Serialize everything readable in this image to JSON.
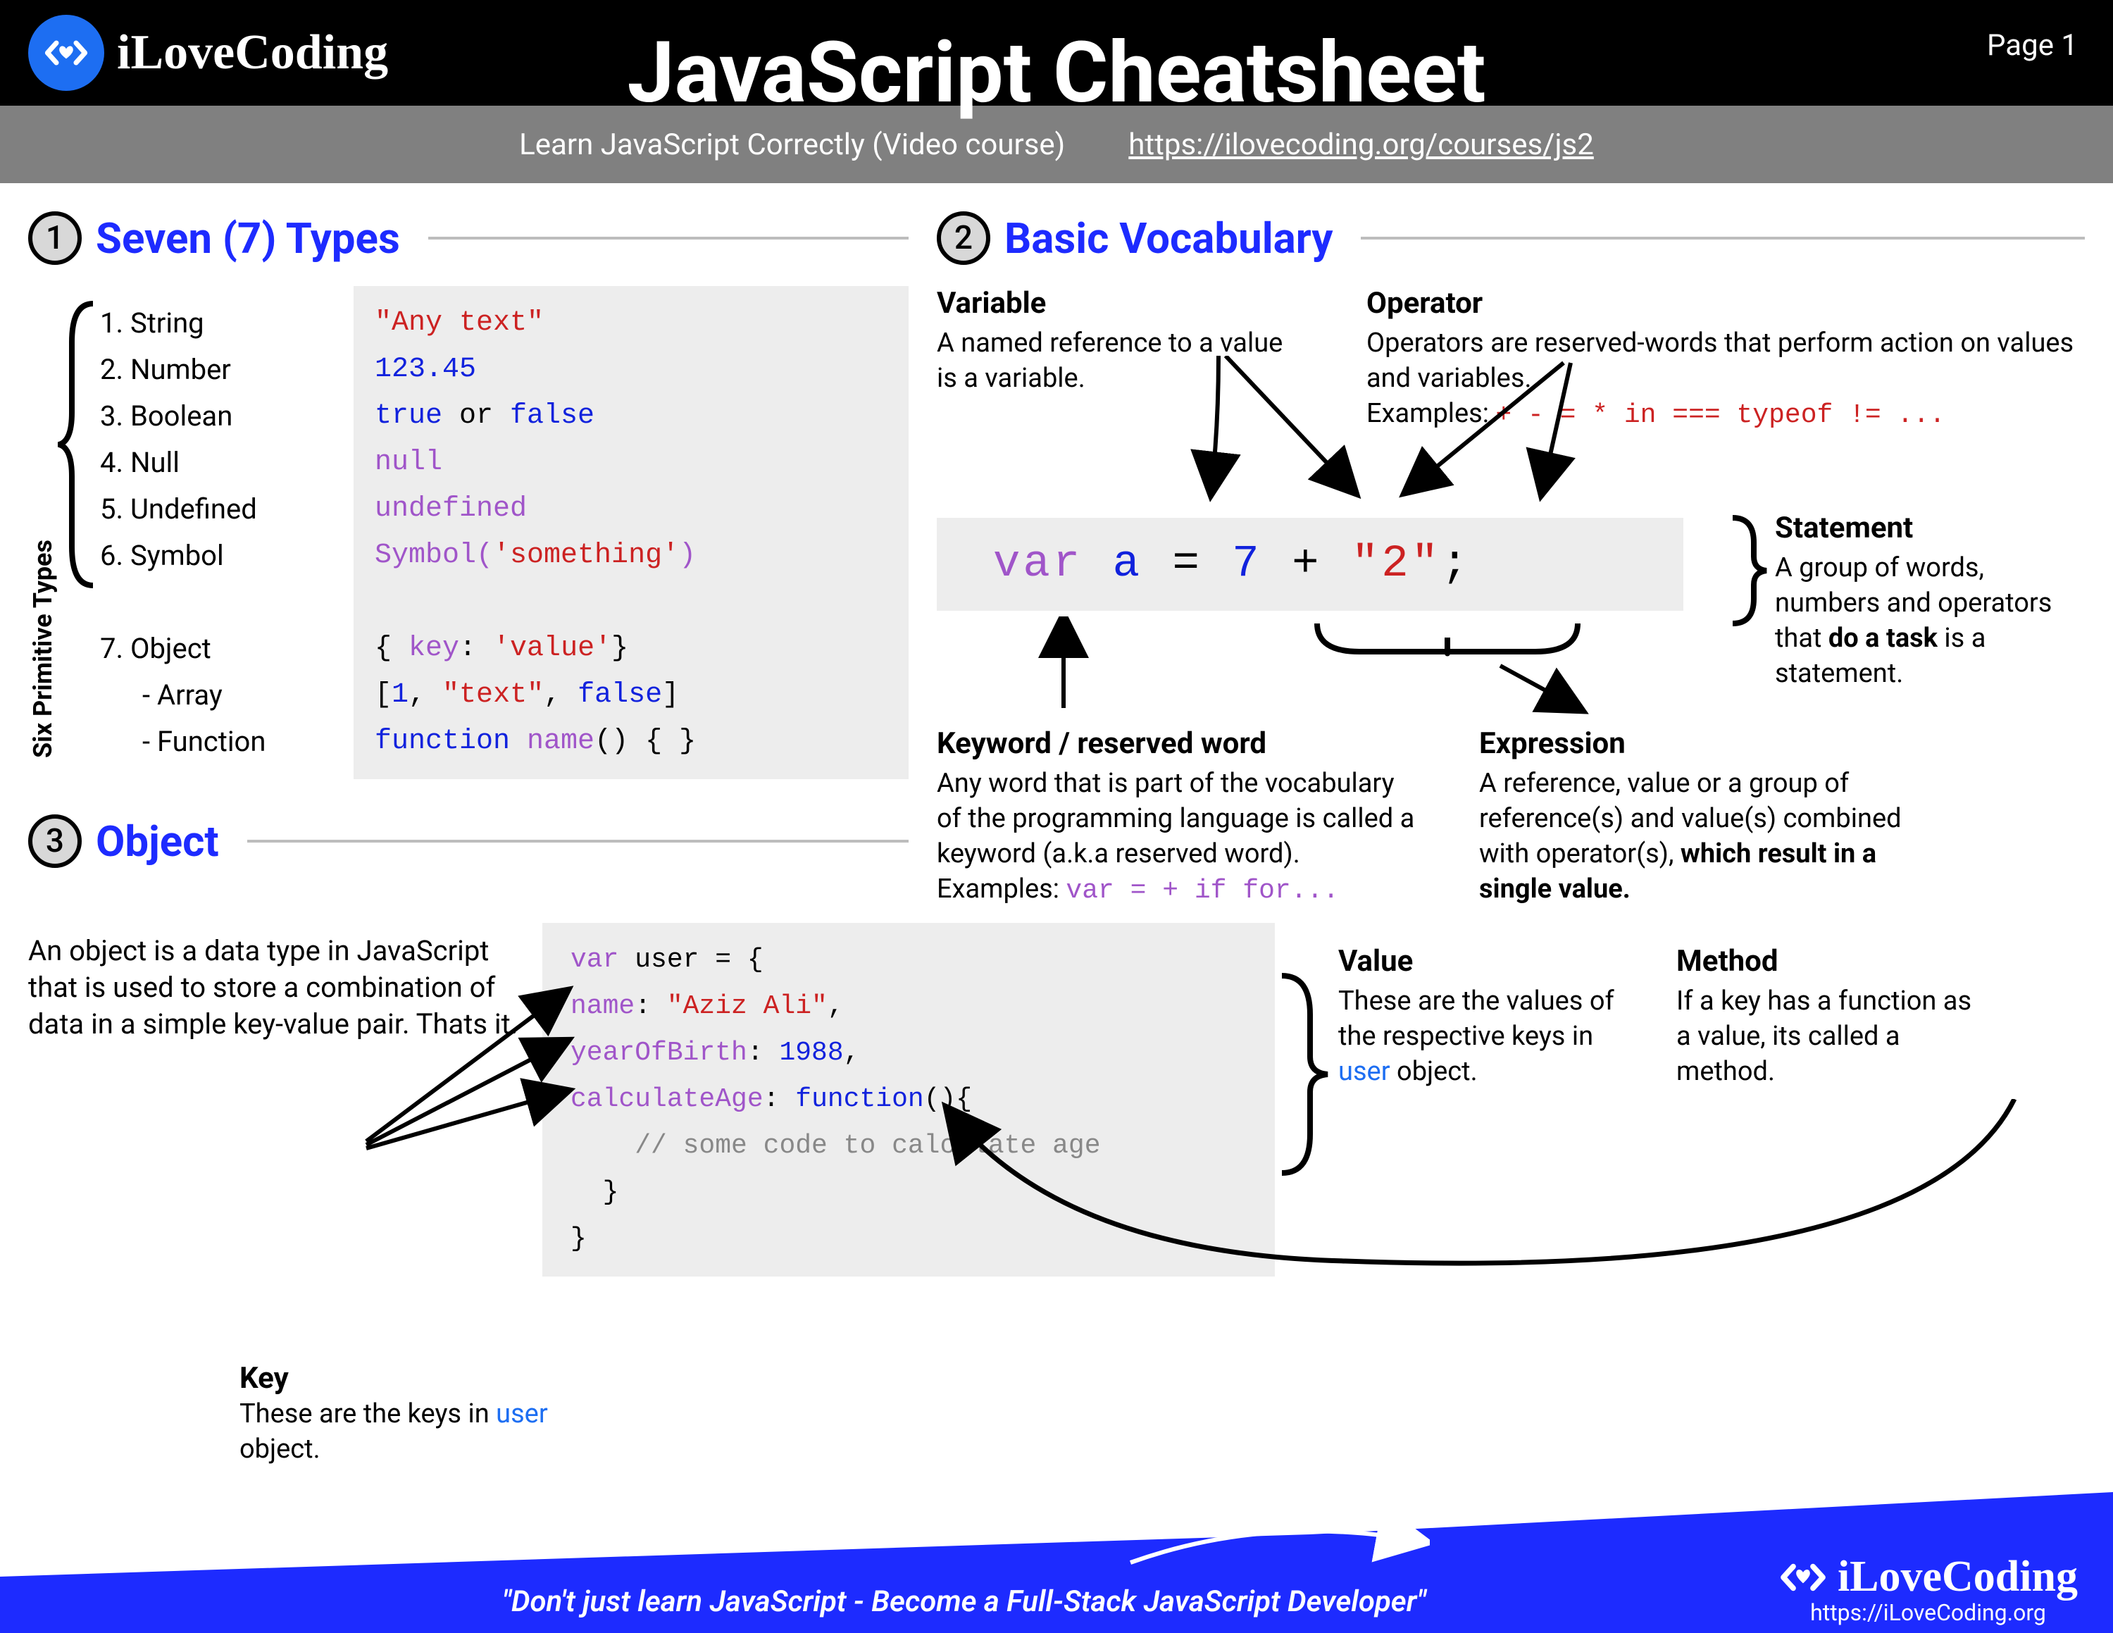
{
  "header": {
    "brand": "iLoveCoding",
    "title": "JavaScript Cheatsheet",
    "page": "Page 1",
    "subtitle_left": "Learn JavaScript Correctly (Video course)",
    "subtitle_link": "https://ilovecoding.org/courses/js2"
  },
  "section1": {
    "num": "1",
    "title": "Seven (7) Types",
    "side_label": "Six Primitive Types",
    "names": {
      "n1": "1.  String",
      "n2": "2.  Number",
      "n3": "3.  Boolean",
      "n4": "4.  Null",
      "n5": "5.  Undefined",
      "n6": "6.  Symbol",
      "n7": "7.  Object",
      "n7a": "-  Array",
      "n7b": "-  Function"
    },
    "code": {
      "l1a": "\"Any text\"",
      "l2a": "123.45",
      "l3a": "true",
      "l3b": " or ",
      "l3c": "false",
      "l4a": "null",
      "l5a": "undefined",
      "l6a": "Symbol(",
      "l6b": "'something'",
      "l6c": ")",
      "l7a": "{ ",
      "l7b": "key",
      "l7c": ": ",
      "l7d": "'value'",
      "l7e": "}",
      "l8a": "[",
      "l8b": "1",
      "l8c": ",",
      "l8d": " \"text\"",
      "l8e": ",",
      "l8f": " false",
      "l8g": "]",
      "l9a": "function ",
      "l9b": "name",
      "l9c": "() { }"
    }
  },
  "section2": {
    "num": "2",
    "title": "Basic Vocabulary",
    "variable": {
      "h": "Variable",
      "t": "A named reference to a value is a variable."
    },
    "operator": {
      "h": "Operator",
      "t": "Operators are reserved-words that perform action on values and variables.",
      "ex_label": "Examples: ",
      "ex": "+ - = * in === typeof != ..."
    },
    "code": {
      "var": "var",
      "a": "a",
      "eq": "=",
      "seven": "7",
      "plus": "+",
      "str": "\"2\"",
      "semi": ";"
    },
    "statement": {
      "h": "Statement",
      "t1": "A group of words, numbers and operators that ",
      "t2": "do a task",
      "t3": " is a statement."
    },
    "keyword": {
      "h": "Keyword / reserved word",
      "t": "Any word that is part of the vocabulary of the programming language is called a keyword (a.k.a reserved word).",
      "ex_label": "Examples: ",
      "ex": "var = + if for..."
    },
    "expression": {
      "h": "Expression",
      "t1": "A reference, value or a group of reference(s) and value(s) combined with operator(s), ",
      "t2": "which result in a single value."
    }
  },
  "section3": {
    "num": "3",
    "title": "Object",
    "desc": "An object is a data type in JavaScript that is used to store a combination of data in a simple key-value pair. Thats it.",
    "code": {
      "l1a": "var",
      "l1b": " user ",
      "l1c": "= {",
      "l2a": "  name",
      "l2b": ": ",
      "l2c": "\"Aziz Ali\"",
      "l2d": ",",
      "l3a": "  yearOfBirth",
      "l3b": ": ",
      "l3c": "1988",
      "l3d": ",",
      "l4a": "  calculateAge",
      "l4b": ": ",
      "l4c": "function",
      "l4d": "(){",
      "l5a": "    // some code to calculate age",
      "l6a": "  }",
      "l7a": "}"
    },
    "key_note": {
      "h": "Key",
      "t1": "These are the keys in ",
      "t2": "user",
      "t3": " object."
    },
    "value_note": {
      "h": "Value",
      "t1": "These are the values of the respective keys in ",
      "t2": "user",
      "t3": " object."
    },
    "method_note": {
      "h": "Method",
      "t": "If a key has a function as a value, its called a method."
    }
  },
  "footer": {
    "quote": "\"Don't just learn JavaScript - Become a Full-Stack JavaScript Developer\"",
    "brand": "iLoveCoding",
    "url": "https://iLoveCoding.org"
  }
}
